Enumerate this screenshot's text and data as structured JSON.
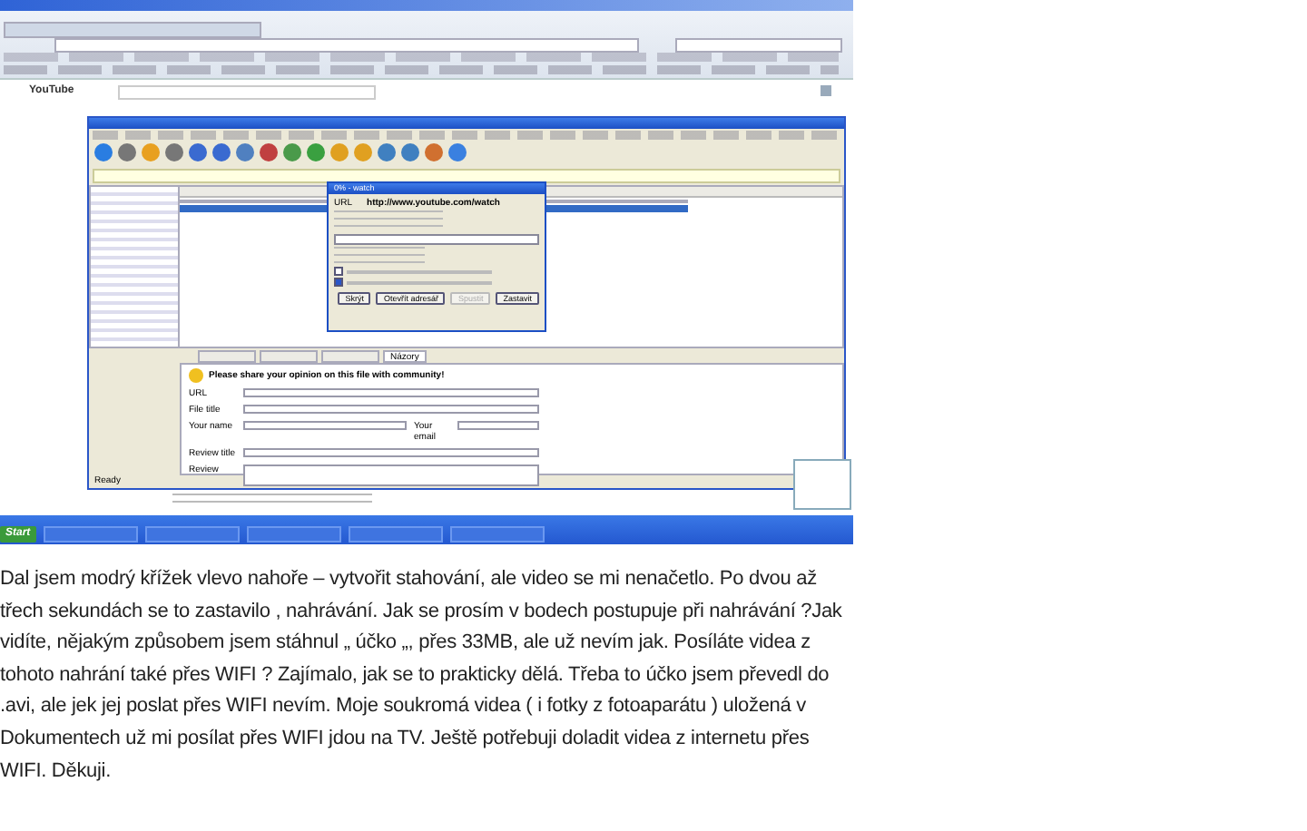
{
  "screenshot": {
    "youtube": {
      "logo": "YouTube"
    },
    "download_window": {
      "tabs": [
        {
          "label": "Názory",
          "selected": true
        }
      ],
      "dialog": {
        "title": "0% - watch",
        "fields": [
          {
            "label": "URL",
            "value": "http://www.youtube.com/watch"
          }
        ],
        "progress": {
          "level": 0
        },
        "checkboxes": [
          {
            "checked": false
          },
          {
            "checked": true
          }
        ],
        "buttons": [
          {
            "label": "Skrýt",
            "disabled": false
          },
          {
            "label": "Otevřít adresář",
            "disabled": false
          },
          {
            "label": "Spustit",
            "disabled": true
          },
          {
            "label": "Zastavit",
            "disabled": false
          }
        ]
      },
      "review_form": {
        "heading": "Please share your opinion on this file with community!",
        "fields": [
          {
            "label": "URL"
          },
          {
            "label": "File title"
          },
          {
            "label": "Your name"
          },
          {
            "label": "Your email"
          },
          {
            "label": "Review title"
          },
          {
            "label": "Review"
          }
        ]
      },
      "status": "Ready"
    },
    "taskbar": {
      "start": "Start"
    }
  },
  "post": {
    "text": "Dal jsem modrý křížek vlevo nahoře – vytvořit stahování, ale video se mi nenačetlo. Po dvou až třech sekundách se to zastavilo , nahrávání. Jak se prosím v bodech postupuje při nahrávání ?Jak vidíte, nějakým způsobem jsem stáhnul „ účko „, přes 33MB, ale už nevím jak. Posíláte videa z tohoto nahrání také přes WIFI ? Zajímalo, jak se to prakticky dělá. Třeba to účko jsem převedl do .avi, ale jek jej poslat přes WIFI nevím. Moje soukromá videa ( i fotky z fotoaparátu )  uložená v Dokumentech už mi posílat přes WIFI jdou na TV. Ještě potřebuji doladit videa z internetu přes WIFI. Děkuji."
  }
}
